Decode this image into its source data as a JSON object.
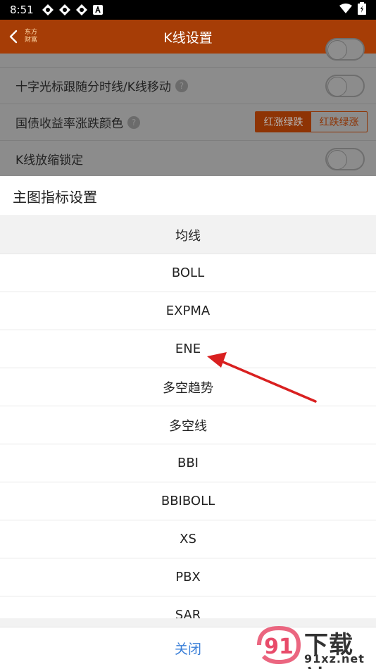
{
  "status_bar": {
    "time": "8:51"
  },
  "header": {
    "title": "K线设置",
    "logo_line1": "东方",
    "logo_line2": "财富"
  },
  "settings": [
    {
      "label": "十字光标跟随分时线/K线移动",
      "control": "toggle"
    },
    {
      "label": "国债收益率涨跌颜色",
      "control": "segmented",
      "options": [
        "红涨绿跌",
        "红跌绿涨"
      ],
      "selected": "红涨绿跌"
    },
    {
      "label": "K线放缩锁定",
      "control": "toggle"
    }
  ],
  "sheet": {
    "title": "主图指标设置",
    "options": [
      "均线",
      "BOLL",
      "EXPMA",
      "ENE",
      "多空趋势",
      "多空线",
      "BBI",
      "BBIBOLL",
      "XS",
      "PBX",
      "SAR"
    ],
    "selected": "均线",
    "cancel_label": "关闭"
  },
  "watermark": {
    "brand_top": "下载站",
    "brand_bottom": "91xz.net",
    "logo_text": "91"
  },
  "colors": {
    "header_bg": "#a63d06",
    "accent_blue": "#3a7fd8",
    "arrow": "#d92020"
  }
}
